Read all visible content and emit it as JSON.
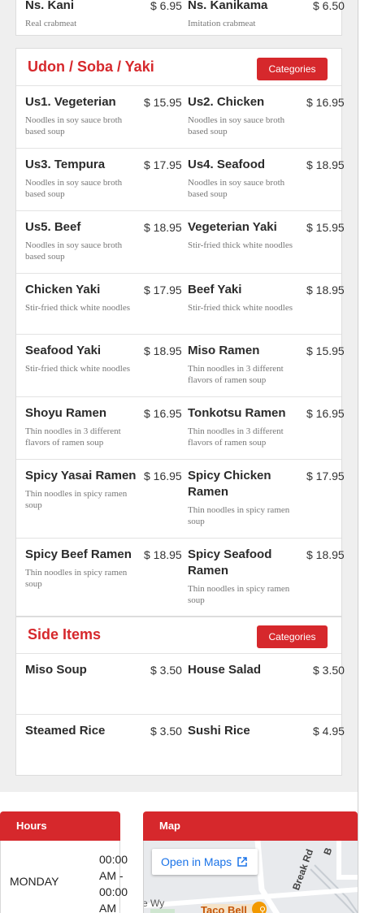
{
  "top_items": [
    {
      "name": "Ns. Kani",
      "price": "$ 6.95",
      "desc": "Real crabmeat"
    },
    {
      "name": "Ns. Kanikama",
      "price": "$ 6.50",
      "desc": "Imitation crabmeat"
    }
  ],
  "udon": {
    "title": "Udon / Soba / Yaki",
    "button": "Categories",
    "items": [
      {
        "name": "Us1. Vegeterian",
        "price": "$ 15.95",
        "desc": "Noodles in soy sauce broth based soup"
      },
      {
        "name": "Us2. Chicken",
        "price": "$ 16.95",
        "desc": "Noodles in soy sauce broth based soup"
      },
      {
        "name": "Us3. Tempura",
        "price": "$ 17.95",
        "desc": "Noodles in soy sauce broth based soup"
      },
      {
        "name": "Us4. Seafood",
        "price": "$ 18.95",
        "desc": "Noodles in soy sauce broth based soup"
      },
      {
        "name": "Us5. Beef",
        "price": "$ 18.95",
        "desc": "Noodles in soy sauce broth based soup"
      },
      {
        "name": "Vegeterian Yaki",
        "price": "$ 15.95",
        "desc": "Stir-fried thick white noodles"
      },
      {
        "name": "Chicken Yaki",
        "price": "$ 17.95",
        "desc": "Stir-fried thick white noodles"
      },
      {
        "name": "Beef Yaki",
        "price": "$ 18.95",
        "desc": "Stir-fried thick white noodles"
      },
      {
        "name": "Seafood Yaki",
        "price": "$ 18.95",
        "desc": "Stir-fried thick white noodles"
      },
      {
        "name": "Miso Ramen",
        "price": "$ 15.95",
        "desc": "Thin noodles in 3 different flavors of ramen soup"
      },
      {
        "name": "Shoyu Ramen",
        "price": "$ 16.95",
        "desc": "Thin noodles in 3 different flavors of ramen soup"
      },
      {
        "name": "Tonkotsu Ramen",
        "price": "$ 16.95",
        "desc": "Thin noodles in 3 different flavors of ramen soup"
      },
      {
        "name": "Spicy Yasai Ramen",
        "price": "$ 16.95",
        "desc": "Thin noodles in spicy ramen soup"
      },
      {
        "name": "Spicy Chicken Ramen",
        "price": "$ 17.95",
        "desc": "Thin noodles in spicy ramen soup"
      },
      {
        "name": "Spicy Beef Ramen",
        "price": "$ 18.95",
        "desc": "Thin noodles in spicy ramen soup"
      },
      {
        "name": "Spicy Seafood Ramen",
        "price": "$ 18.95",
        "desc": "Thin noodles in spicy ramen soup"
      }
    ]
  },
  "sides": {
    "title": "Side Items",
    "button": "Categories",
    "items": [
      {
        "name": "Miso Soup",
        "price": "$ 3.50",
        "desc": ""
      },
      {
        "name": "House Salad",
        "price": "$ 3.50",
        "desc": ""
      },
      {
        "name": "Steamed Rice",
        "price": "$ 3.50",
        "desc": ""
      },
      {
        "name": "Sushi Rice",
        "price": "$ 4.95",
        "desc": ""
      }
    ]
  },
  "hours": {
    "tab": "Hours",
    "day": "MONDAY",
    "time_lines": [
      "00:00",
      "AM -",
      "00:00",
      "AM"
    ]
  },
  "map": {
    "tab": "Map",
    "open_label": "Open in Maps",
    "street_wy": "e Wy",
    "street_break": "Break Rd",
    "street_b": "B",
    "poi": "Taco Bell"
  },
  "colors": {
    "accent": "#d6282c",
    "link": "#1a73e8"
  },
  "icons": {
    "external": "external-link-icon",
    "restaurant": "restaurant-icon"
  }
}
